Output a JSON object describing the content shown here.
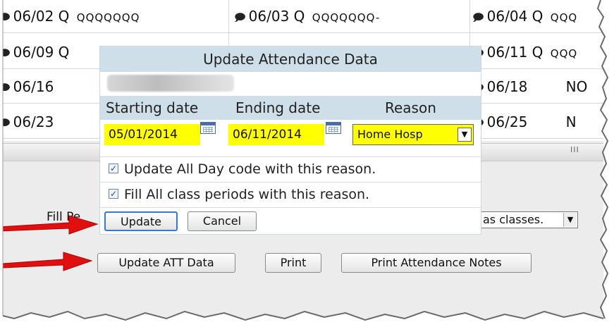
{
  "grid": {
    "rows": [
      [
        {
          "date": "06/02",
          "q": "Q",
          "codes": "QQQQQQQ"
        },
        {
          "date": "06/03",
          "q": "Q",
          "codes": "QQQQQQQ-"
        },
        {
          "date": "06/04",
          "q": "Q",
          "codes": "QQQ"
        }
      ],
      [
        {
          "date": "06/09",
          "q": "Q",
          "codes": ""
        },
        {
          "date": "",
          "q": "",
          "codes": ""
        },
        {
          "date": "06/11",
          "q": "Q",
          "codes": "QQQ"
        }
      ],
      [
        {
          "date": "06/16",
          "q": "",
          "codes": ""
        },
        {
          "date": "",
          "q": "",
          "codes": ""
        },
        {
          "date": "06/18",
          "q": "",
          "codes": "NO"
        }
      ],
      [
        {
          "date": "06/23",
          "q": "",
          "codes": ""
        },
        {
          "date": "",
          "q": "",
          "codes": ""
        },
        {
          "date": "06/25",
          "q": "",
          "codes": "N"
        }
      ]
    ],
    "scroll_grip": "III"
  },
  "dialog": {
    "title": "Update Attendance Data",
    "headers": {
      "starting_date": "Starting date",
      "ending_date": "Ending date",
      "reason": "Reason"
    },
    "starting_date_value": "05/01/2014",
    "ending_date_value": "06/11/2014",
    "reason_value": "Home Hosp",
    "option_all_day": "Update All Day code with this reason.",
    "option_all_day_checked": true,
    "option_fill_periods": "Fill All class periods with this reason.",
    "option_fill_periods_checked": true,
    "update_label": "Update",
    "cancel_label": "Cancel"
  },
  "page": {
    "fill_label_partial": "Fill Pe",
    "classes_select_value": "as classes.",
    "update_att_label": "Update ATT Data",
    "print_label": "Print",
    "print_notes_label": "Print Attendance Notes"
  },
  "icons": {
    "note": "note-icon",
    "calendar": "calendar-icon",
    "dropdown": "chevron-down-icon",
    "checkbox": "checkbox-checked-icon",
    "annotation_arrow": "arrow-right-icon"
  },
  "colors": {
    "dialog_header_bg": "#cfdfe9",
    "highlight_yellow": "#ffff00",
    "annotation_red": "#e01010",
    "page_bg": "#ececec"
  }
}
